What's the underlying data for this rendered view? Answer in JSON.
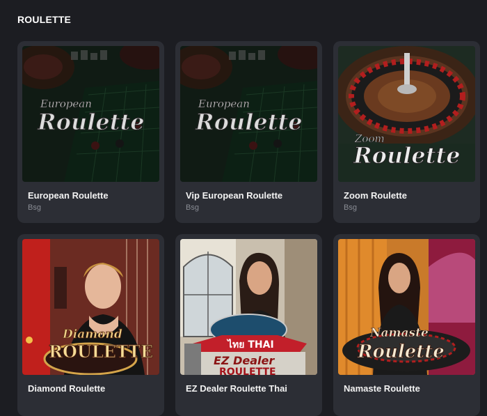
{
  "section": {
    "title": "ROULETTE"
  },
  "games": [
    {
      "name": "European Roulette",
      "provider": "Bsg",
      "logo_top": "European",
      "logo_main": "Roulette"
    },
    {
      "name": "Vip European Roulette",
      "provider": "Bsg",
      "logo_top": "European",
      "logo_main": "Roulette"
    },
    {
      "name": "Zoom Roulette",
      "provider": "Bsg",
      "logo_top": "Zoom",
      "logo_main": "Roulette"
    },
    {
      "name": "Diamond Roulette",
      "provider": "",
      "logo_top": "Diamond",
      "logo_main": "ROULETTE"
    },
    {
      "name": "EZ Dealer Roulette Thai",
      "provider": "",
      "logo_top": "ไทย THAI",
      "logo_mid": "EZ Dealer",
      "logo_main": "ROULETTE"
    },
    {
      "name": "Namaste Roulette",
      "provider": "",
      "logo_top": "Namaste",
      "logo_main": "Roulette"
    }
  ]
}
